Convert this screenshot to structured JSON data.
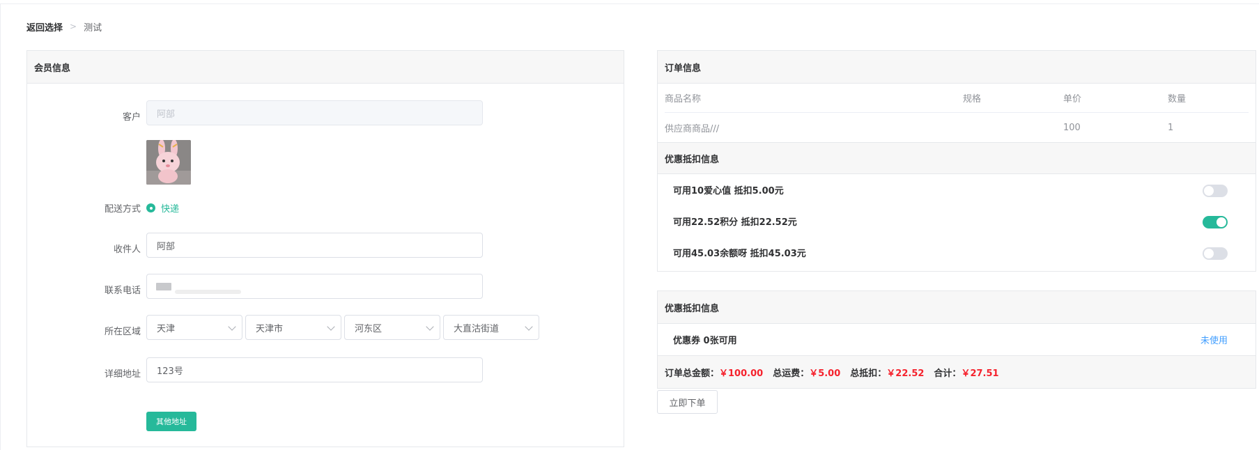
{
  "breadcrumb": {
    "back": "返回选择",
    "current": "测试"
  },
  "member": {
    "title": "会员信息",
    "customer_label": "客户",
    "customer_placeholder": "阿部",
    "delivery_label": "配送方式",
    "delivery_option": "快递",
    "receiver_label": "收件人",
    "receiver_value": "阿部",
    "phone_label": "联系电话",
    "region_label": "所在区域",
    "region": {
      "province": "天津",
      "city": "天津市",
      "district": "河东区",
      "street": "大直沽街道"
    },
    "address_label": "详细地址",
    "address_value": "123号",
    "other_address_button": "其他地址"
  },
  "order": {
    "title": "订单信息",
    "columns": {
      "name": "商品名称",
      "spec": "规格",
      "price": "单价",
      "qty": "数量"
    },
    "rows": [
      {
        "name": "供应商商品///",
        "spec": "",
        "price": "100",
        "qty": "1"
      }
    ],
    "discount_title": "优惠抵扣信息",
    "discounts": [
      {
        "label": "可用10爱心值 抵扣5.00元",
        "enabled": false
      },
      {
        "label": "可用22.52积分 抵扣22.52元",
        "enabled": true
      },
      {
        "label": "可用45.03余额呀 抵扣45.03元",
        "enabled": false
      }
    ]
  },
  "coupon": {
    "title": "优惠抵扣信息",
    "coupon_label": "优惠券 0张可用",
    "coupon_status": "未使用",
    "totals": {
      "total_label": "订单总金额：",
      "total_value": "￥100.00",
      "shipping_label": "总运费：",
      "shipping_value": "￥5.00",
      "deduction_label": "总抵扣：",
      "deduction_value": "￥22.52",
      "sum_label": "合计：",
      "sum_value": "￥27.51"
    }
  },
  "place_order_button": "立即下单",
  "colors": {
    "accent": "#26b99a",
    "price": "#f5222d",
    "link": "#409eff"
  }
}
